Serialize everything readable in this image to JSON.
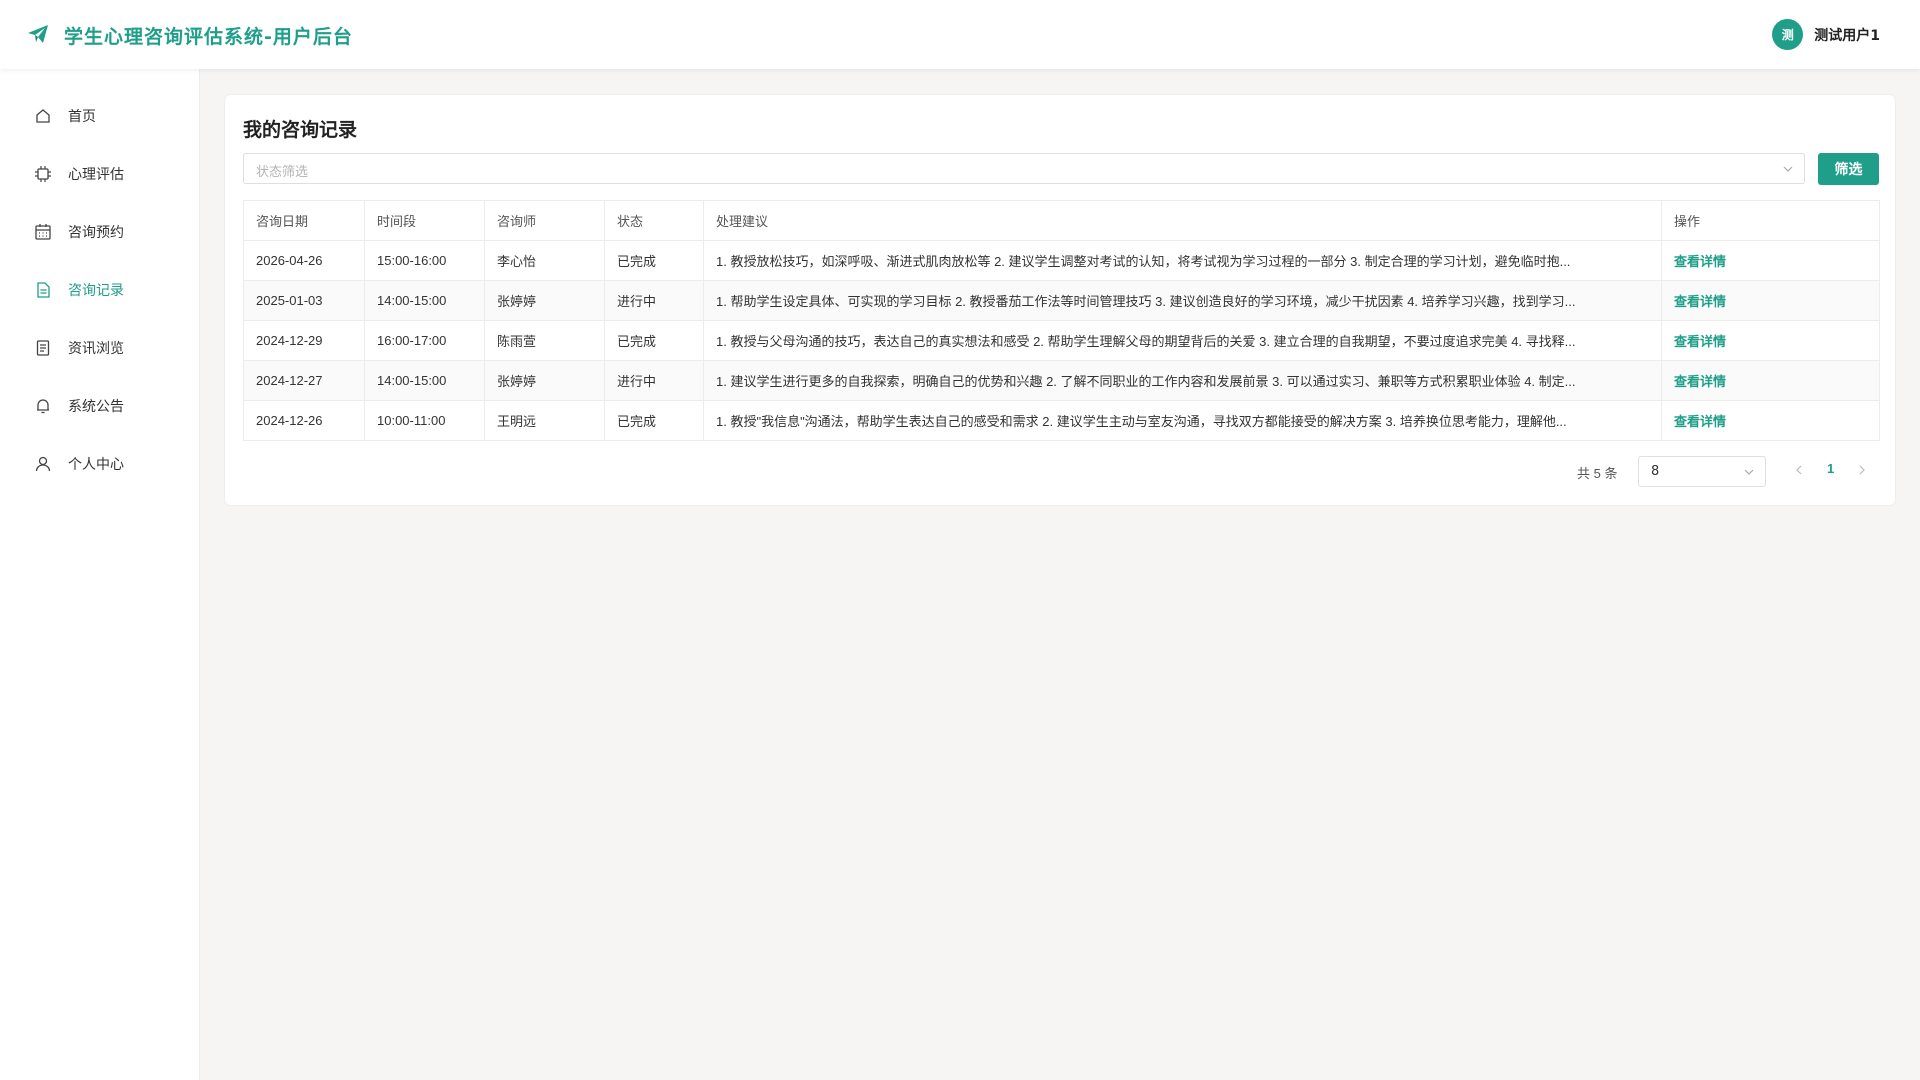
{
  "header": {
    "title": "学生心理咨询评估系统-用户后台",
    "user_avatar_text": "测",
    "user_name": "测试用户1",
    "accent_color": "#1f9e8a"
  },
  "sidebar": {
    "items": [
      {
        "label": "首页",
        "icon": "home-icon"
      },
      {
        "label": "心理评估",
        "icon": "chip-icon"
      },
      {
        "label": "咨询预约",
        "icon": "calendar-icon"
      },
      {
        "label": "咨询记录",
        "icon": "document-icon",
        "active": true
      },
      {
        "label": "资讯浏览",
        "icon": "reader-icon"
      },
      {
        "label": "系统公告",
        "icon": "bell-icon"
      },
      {
        "label": "个人中心",
        "icon": "user-icon"
      }
    ]
  },
  "main": {
    "title": "我的咨询记录",
    "filter": {
      "placeholder": "状态筛选",
      "button_label": "筛选"
    },
    "table": {
      "columns": [
        "咨询日期",
        "时间段",
        "咨询师",
        "状态",
        "处理建议",
        "操作"
      ],
      "rows": [
        {
          "date": "2026-04-26",
          "time": "15:00-16:00",
          "counselor": "李心怡",
          "status": "已完成",
          "advice": "1. 教授放松技巧，如深呼吸、渐进式肌肉放松等 2. 建议学生调整对考试的认知，将考试视为学习过程的一部分 3. 制定合理的学习计划，避免临时抱...",
          "action": "查看详情"
        },
        {
          "date": "2025-01-03",
          "time": "14:00-15:00",
          "counselor": "张婷婷",
          "status": "进行中",
          "advice": "1. 帮助学生设定具体、可实现的学习目标 2. 教授番茄工作法等时间管理技巧 3. 建议创造良好的学习环境，减少干扰因素 4. 培养学习兴趣，找到学习...",
          "action": "查看详情"
        },
        {
          "date": "2024-12-29",
          "time": "16:00-17:00",
          "counselor": "陈雨萱",
          "status": "已完成",
          "advice": "1. 教授与父母沟通的技巧，表达自己的真实想法和感受 2. 帮助学生理解父母的期望背后的关爱 3. 建立合理的自我期望，不要过度追求完美 4. 寻找释...",
          "action": "查看详情"
        },
        {
          "date": "2024-12-27",
          "time": "14:00-15:00",
          "counselor": "张婷婷",
          "status": "进行中",
          "advice": "1. 建议学生进行更多的自我探索，明确自己的优势和兴趣 2. 了解不同职业的工作内容和发展前景 3. 可以通过实习、兼职等方式积累职业体验 4. 制定...",
          "action": "查看详情"
        },
        {
          "date": "2024-12-26",
          "time": "10:00-11:00",
          "counselor": "王明远",
          "status": "已完成",
          "advice": "1. 教授\"我信息\"沟通法，帮助学生表达自己的感受和需求 2. 建议学生主动与室友沟通，寻找双方都能接受的解决方案 3. 培养换位思考能力，理解他...",
          "action": "查看详情"
        }
      ]
    },
    "pagination": {
      "total_text": "共 5 条",
      "page_size": "8",
      "current_page": "1"
    }
  }
}
